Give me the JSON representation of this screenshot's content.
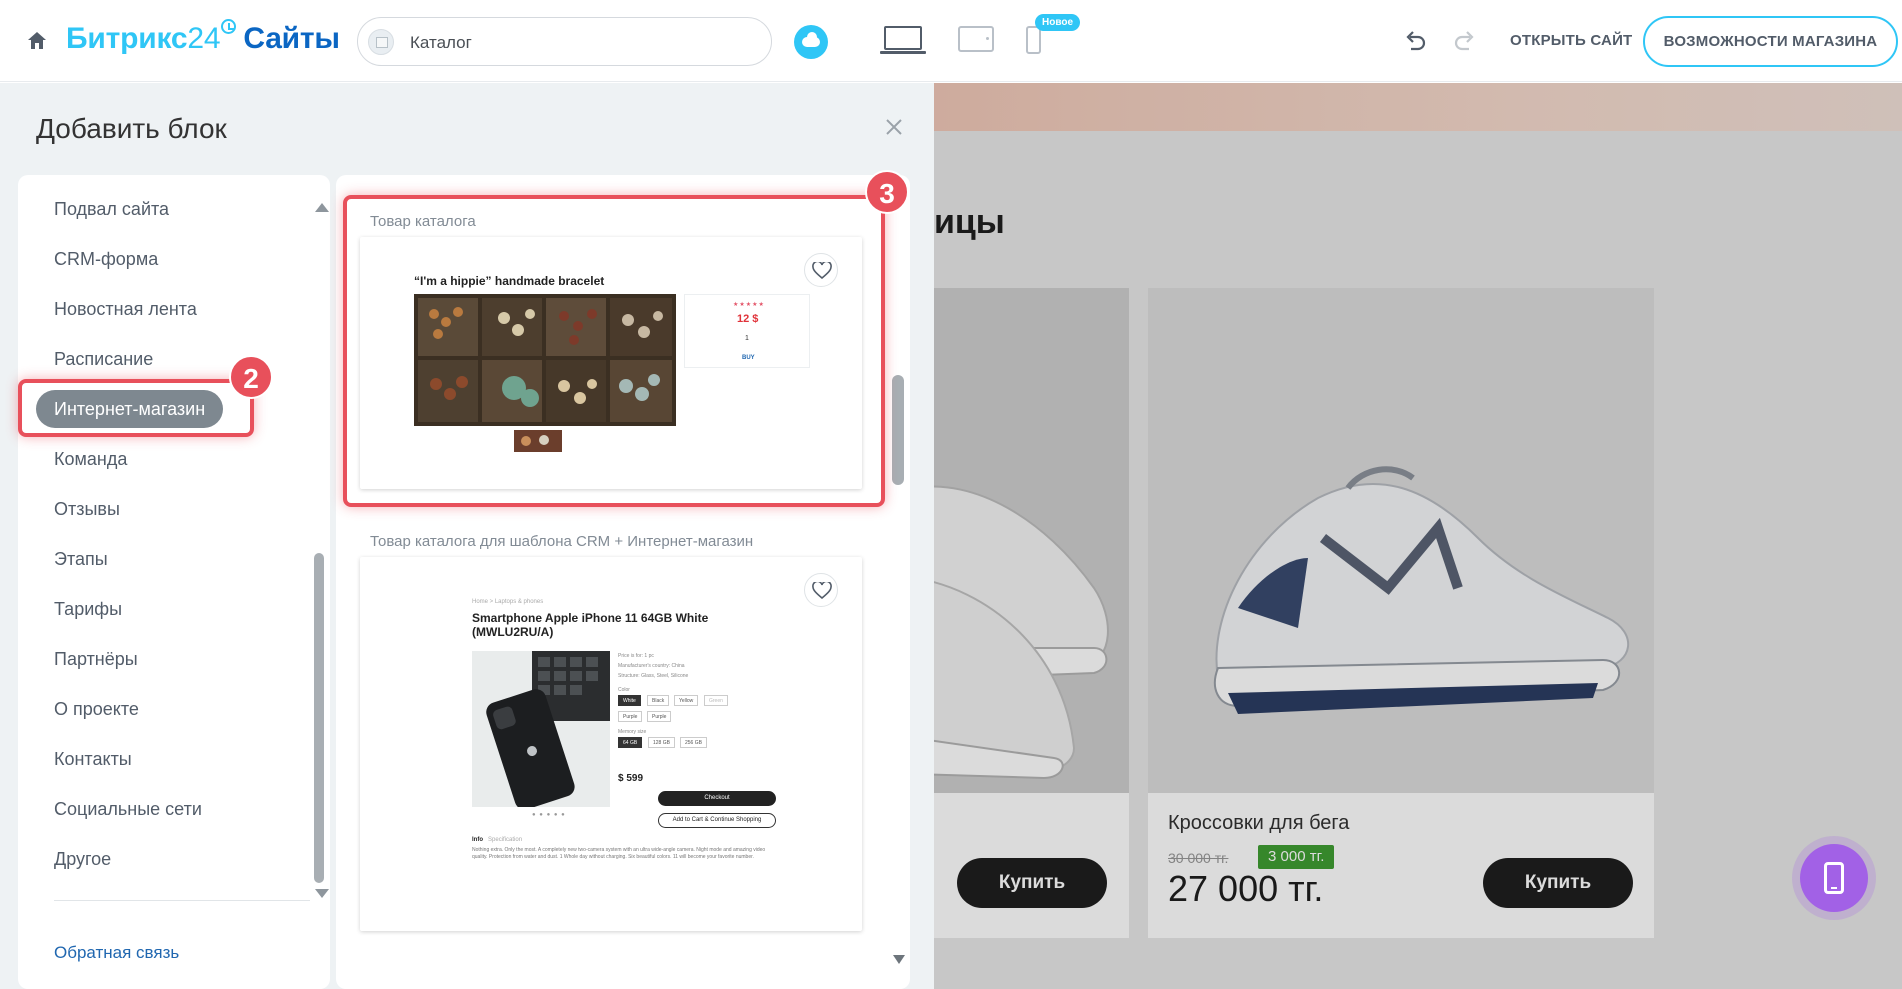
{
  "header": {
    "logo_part1": "Битрикс",
    "logo_part2": "24",
    "logo_part3": "Сайты",
    "page_select_value": "Каталог",
    "new_badge": "Новое",
    "open_site": "ОТКРЫТЬ САЙТ",
    "features_button": "ВОЗМОЖНОСТИ МАГАЗИНА"
  },
  "panel": {
    "title": "Добавить блок",
    "categories": [
      "Подвал сайта",
      "CRM-форма",
      "Новостная лента",
      "Расписание",
      "Интернет-магазин",
      "Команда",
      "Отзывы",
      "Этапы",
      "Тарифы",
      "Партнёры",
      "О проекте",
      "Контакты",
      "Социальные сети",
      "Другое"
    ],
    "active_category": "Интернет-магазин",
    "feedback_link": "Обратная связь",
    "blocks": [
      {
        "label": "Товар каталога",
        "preview": {
          "title": "“I'm a hippie” handmade bracelet",
          "stars": "★★★★★",
          "price": "12 $",
          "qty": "1",
          "buy": "BUY"
        }
      },
      {
        "label": "Товар каталога для шаблона CRM + Интернет-магазин",
        "preview": {
          "breadcrumb": "Home  >  Laptops & phones",
          "title": "Smartphone Apple iPhone 11 64GB White (MWLU2RU/A)",
          "price_for": "Price is for: 1 pc",
          "country": "Manufacturer's country: China",
          "structure": "Structure: Glass, Steel, Silicone",
          "color_label": "Color",
          "colors": [
            "White",
            "Black",
            "Yellow",
            "Green",
            "Purple",
            "Purple"
          ],
          "memory_label": "Memory size",
          "memory": [
            "64 GB",
            "128 GB",
            "256 GB"
          ],
          "price": "$ 599",
          "checkout": "Checkout",
          "add_to_cart": "Add to Cart & Continue Shopping",
          "tab_info": "Info",
          "tab_spec": "Specification",
          "description": "Nothing extra. Only the most. A completely new two-camera system with an ultra wide-angle camera. Night mode and amazing video quality. Protection from water and dust. 1 Whole day without charging. Six beautiful colors. 11 will become your favorite number."
        }
      }
    ]
  },
  "preview": {
    "heading_fragment": "ицы",
    "card1_buy": "Купить",
    "card2_name": "Кроссовки для бега",
    "card2_old_price": "30 000 тг.",
    "card2_discount": "3 000 тг.",
    "card2_price": "27 000 тг.",
    "card2_buy": "Купить"
  },
  "annotations": {
    "step2": "2",
    "step3": "3"
  },
  "colors": {
    "accent": "#2fc6f6",
    "brand_dark": "#0b66c3",
    "annotation": "#e8505b",
    "active_pill": "#7e8890",
    "fab": "#a261e6",
    "discount": "#3f9e33"
  }
}
